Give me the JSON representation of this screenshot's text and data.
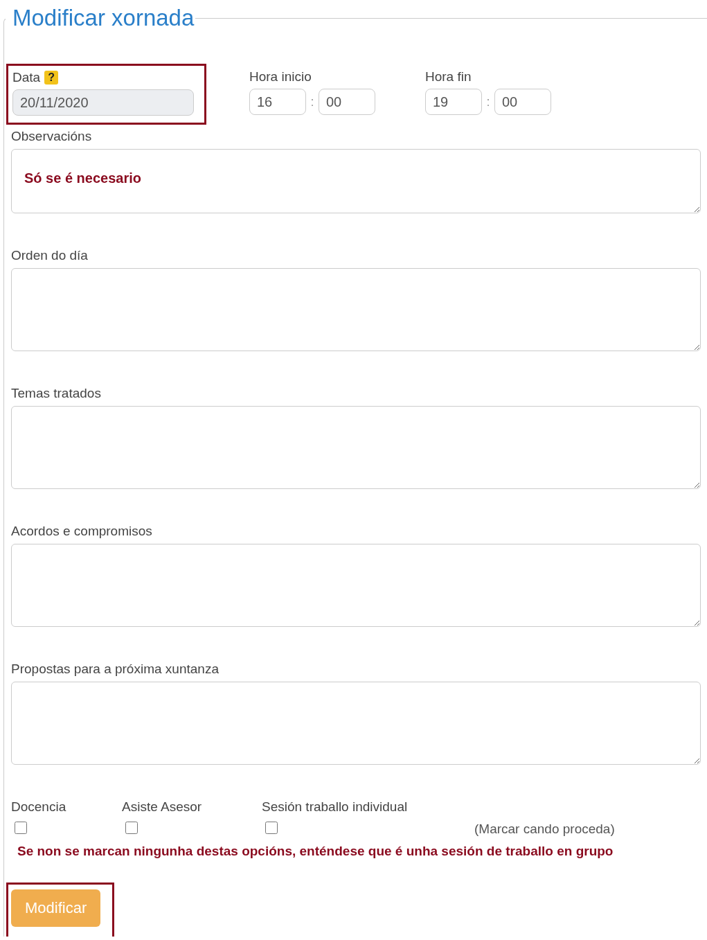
{
  "form": {
    "title": "Modificar xornada",
    "date": {
      "label": "Data",
      "help": "?",
      "value": "20/11/2020",
      "disabled": true,
      "highlighted": true
    },
    "times": [
      {
        "label": "Hora inicio",
        "hour": "16",
        "separator": ":",
        "minute": "00"
      },
      {
        "label": "Hora fin",
        "hour": "19",
        "separator": ":",
        "minute": "00"
      }
    ],
    "text_areas": [
      {
        "label": "Observacións",
        "value": "Só se é necesario"
      },
      {
        "label": "Orden do día"
      },
      {
        "label": "Temas tratados"
      },
      {
        "label": "Acordos e compromisos"
      },
      {
        "label": "Propostas para a próxima xuntanza"
      }
    ],
    "checkboxes": [
      {
        "label": "Docencia",
        "checked": false
      },
      {
        "label": "Asiste Asesor",
        "checked": false
      },
      {
        "label": "Sesión traballo individual",
        "checked": false
      }
    ],
    "hint": "(Marcar cando proceda)",
    "warning": "Se non se marcan ningunha destas opcións, enténdese que é unha sesión de traballo en grupo",
    "submit": {
      "label": "Modificar",
      "highlighted": true
    }
  }
}
